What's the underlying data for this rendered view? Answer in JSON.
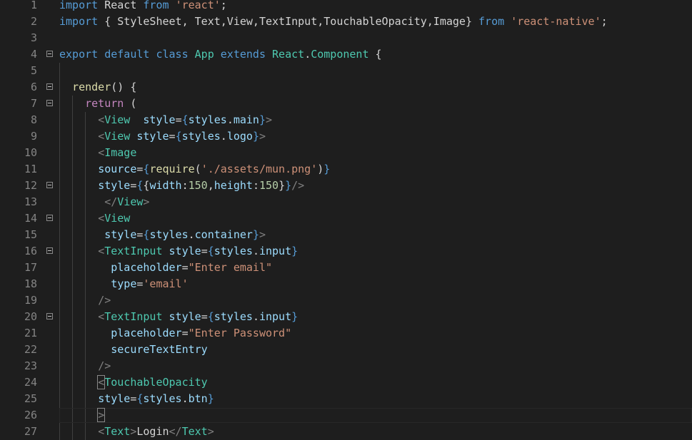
{
  "editor": {
    "colors": {
      "background": "#1e1e1e",
      "line_number": "#858585",
      "keyword": "#569cd6",
      "control": "#c586c0",
      "string": "#ce9178",
      "class": "#4ec9b0",
      "function": "#dcdcaa",
      "variable": "#9cdcfe",
      "number": "#b5cea8",
      "punctuation": "#808080",
      "plain": "#d4d4d4"
    },
    "current_line": 26,
    "lines": [
      {
        "n": "1",
        "fold": false,
        "tokens": [
          [
            "kw",
            "import"
          ],
          [
            "plain",
            " React "
          ],
          [
            "kw",
            "from"
          ],
          [
            "plain",
            " "
          ],
          [
            "str",
            "'react'"
          ],
          [
            "plain",
            ";"
          ]
        ]
      },
      {
        "n": "2",
        "fold": false,
        "tokens": [
          [
            "kw",
            "import"
          ],
          [
            "plain",
            " { StyleSheet, Text,View,TextInput,TouchableOpacity,Image} "
          ],
          [
            "kw",
            "from"
          ],
          [
            "plain",
            " "
          ],
          [
            "str",
            "'react-native'"
          ],
          [
            "plain",
            ";"
          ]
        ]
      },
      {
        "n": "3",
        "fold": false,
        "tokens": []
      },
      {
        "n": "4",
        "fold": true,
        "tokens": [
          [
            "kw",
            "export"
          ],
          [
            "plain",
            " "
          ],
          [
            "kw",
            "default"
          ],
          [
            "plain",
            " "
          ],
          [
            "kw",
            "class"
          ],
          [
            "plain",
            " "
          ],
          [
            "cls",
            "App"
          ],
          [
            "plain",
            " "
          ],
          [
            "kw",
            "extends"
          ],
          [
            "plain",
            " "
          ],
          [
            "cls",
            "React"
          ],
          [
            "plain",
            "."
          ],
          [
            "cls",
            "Component"
          ],
          [
            "plain",
            " {"
          ]
        ]
      },
      {
        "n": "5",
        "fold": false,
        "tokens": []
      },
      {
        "n": "6",
        "fold": true,
        "tokens": [
          [
            "plain",
            "  "
          ],
          [
            "fn",
            "render"
          ],
          [
            "plain",
            "() {"
          ]
        ]
      },
      {
        "n": "7",
        "fold": true,
        "tokens": [
          [
            "plain",
            "    "
          ],
          [
            "ctrl",
            "return"
          ],
          [
            "plain",
            " ("
          ]
        ]
      },
      {
        "n": "8",
        "fold": false,
        "tokens": [
          [
            "plain",
            "      "
          ],
          [
            "brk",
            "<"
          ],
          [
            "tag",
            "View"
          ],
          [
            "plain",
            "  "
          ],
          [
            "var",
            "style"
          ],
          [
            "plain",
            "="
          ],
          [
            "kw",
            "{"
          ],
          [
            "var",
            "styles"
          ],
          [
            "plain",
            "."
          ],
          [
            "var",
            "main"
          ],
          [
            "kw",
            "}"
          ],
          [
            "brk",
            ">"
          ]
        ]
      },
      {
        "n": "9",
        "fold": false,
        "tokens": [
          [
            "plain",
            "      "
          ],
          [
            "brk",
            "<"
          ],
          [
            "tag",
            "View"
          ],
          [
            "plain",
            " "
          ],
          [
            "var",
            "style"
          ],
          [
            "plain",
            "="
          ],
          [
            "kw",
            "{"
          ],
          [
            "var",
            "styles"
          ],
          [
            "plain",
            "."
          ],
          [
            "var",
            "logo"
          ],
          [
            "kw",
            "}"
          ],
          [
            "brk",
            ">"
          ]
        ]
      },
      {
        "n": "10",
        "fold": false,
        "tokens": [
          [
            "plain",
            "      "
          ],
          [
            "brk",
            "<"
          ],
          [
            "tag",
            "Image"
          ]
        ]
      },
      {
        "n": "11",
        "fold": false,
        "tokens": [
          [
            "plain",
            "      "
          ],
          [
            "var",
            "source"
          ],
          [
            "plain",
            "="
          ],
          [
            "kw",
            "{"
          ],
          [
            "fn",
            "require"
          ],
          [
            "plain",
            "("
          ],
          [
            "str",
            "'./assets/mun.png'"
          ],
          [
            "plain",
            ")"
          ],
          [
            "kw",
            "}"
          ]
        ]
      },
      {
        "n": "12",
        "fold": true,
        "tokens": [
          [
            "plain",
            "      "
          ],
          [
            "var",
            "style"
          ],
          [
            "plain",
            "="
          ],
          [
            "kw",
            "{"
          ],
          [
            "plain",
            "{"
          ],
          [
            "var",
            "width"
          ],
          [
            "plain",
            ":"
          ],
          [
            "num",
            "150"
          ],
          [
            "plain",
            ","
          ],
          [
            "var",
            "height"
          ],
          [
            "plain",
            ":"
          ],
          [
            "num",
            "150"
          ],
          [
            "plain",
            "}"
          ],
          [
            "kw",
            "}"
          ],
          [
            "brk",
            "/>"
          ]
        ]
      },
      {
        "n": "13",
        "fold": false,
        "tokens": [
          [
            "plain",
            "       "
          ],
          [
            "brk",
            "</"
          ],
          [
            "tag",
            "View"
          ],
          [
            "brk",
            ">"
          ]
        ]
      },
      {
        "n": "14",
        "fold": true,
        "tokens": [
          [
            "plain",
            "      "
          ],
          [
            "brk",
            "<"
          ],
          [
            "tag",
            "View"
          ]
        ]
      },
      {
        "n": "15",
        "fold": false,
        "tokens": [
          [
            "plain",
            "       "
          ],
          [
            "var",
            "style"
          ],
          [
            "plain",
            "="
          ],
          [
            "kw",
            "{"
          ],
          [
            "var",
            "styles"
          ],
          [
            "plain",
            "."
          ],
          [
            "var",
            "container"
          ],
          [
            "kw",
            "}"
          ],
          [
            "brk",
            ">"
          ]
        ]
      },
      {
        "n": "16",
        "fold": true,
        "tokens": [
          [
            "plain",
            "      "
          ],
          [
            "brk",
            "<"
          ],
          [
            "tag",
            "TextInput"
          ],
          [
            "plain",
            " "
          ],
          [
            "var",
            "style"
          ],
          [
            "plain",
            "="
          ],
          [
            "kw",
            "{"
          ],
          [
            "var",
            "styles"
          ],
          [
            "plain",
            "."
          ],
          [
            "var",
            "input"
          ],
          [
            "kw",
            "}"
          ]
        ]
      },
      {
        "n": "17",
        "fold": false,
        "tokens": [
          [
            "plain",
            "        "
          ],
          [
            "var",
            "placeholder"
          ],
          [
            "plain",
            "="
          ],
          [
            "str",
            "\"Enter email\""
          ]
        ]
      },
      {
        "n": "18",
        "fold": false,
        "tokens": [
          [
            "plain",
            "        "
          ],
          [
            "var",
            "type"
          ],
          [
            "plain",
            "="
          ],
          [
            "str",
            "'email'"
          ]
        ]
      },
      {
        "n": "19",
        "fold": false,
        "tokens": [
          [
            "plain",
            "      "
          ],
          [
            "brk",
            "/>"
          ]
        ]
      },
      {
        "n": "20",
        "fold": true,
        "tokens": [
          [
            "plain",
            "      "
          ],
          [
            "brk",
            "<"
          ],
          [
            "tag",
            "TextInput"
          ],
          [
            "plain",
            " "
          ],
          [
            "var",
            "style"
          ],
          [
            "plain",
            "="
          ],
          [
            "kw",
            "{"
          ],
          [
            "var",
            "styles"
          ],
          [
            "plain",
            "."
          ],
          [
            "var",
            "input"
          ],
          [
            "kw",
            "}"
          ]
        ]
      },
      {
        "n": "21",
        "fold": false,
        "tokens": [
          [
            "plain",
            "        "
          ],
          [
            "var",
            "placeholder"
          ],
          [
            "plain",
            "="
          ],
          [
            "str",
            "\"Enter Password\""
          ]
        ]
      },
      {
        "n": "22",
        "fold": false,
        "tokens": [
          [
            "plain",
            "        "
          ],
          [
            "var",
            "secureTextEntry"
          ]
        ]
      },
      {
        "n": "23",
        "fold": false,
        "tokens": [
          [
            "plain",
            "      "
          ],
          [
            "brk",
            "/>"
          ]
        ]
      },
      {
        "n": "24",
        "fold": false,
        "tokens": [
          [
            "plain",
            "      "
          ],
          [
            "brk",
            "<"
          ],
          [
            "tag",
            "TouchableOpacity"
          ]
        ]
      },
      {
        "n": "25",
        "fold": false,
        "tokens": [
          [
            "plain",
            "      "
          ],
          [
            "var",
            "style"
          ],
          [
            "plain",
            "="
          ],
          [
            "kw",
            "{"
          ],
          [
            "var",
            "styles"
          ],
          [
            "plain",
            "."
          ],
          [
            "var",
            "btn"
          ],
          [
            "kw",
            "}"
          ]
        ]
      },
      {
        "n": "26",
        "fold": false,
        "tokens": [
          [
            "plain",
            "      "
          ],
          [
            "brk",
            ">"
          ]
        ]
      },
      {
        "n": "27",
        "fold": false,
        "tokens": [
          [
            "plain",
            "      "
          ],
          [
            "brk",
            "<"
          ],
          [
            "tag",
            "Text"
          ],
          [
            "brk",
            ">"
          ],
          [
            "plain",
            "Login"
          ],
          [
            "brk",
            "</"
          ],
          [
            "tag",
            "Text"
          ],
          [
            "brk",
            ">"
          ]
        ]
      }
    ]
  }
}
